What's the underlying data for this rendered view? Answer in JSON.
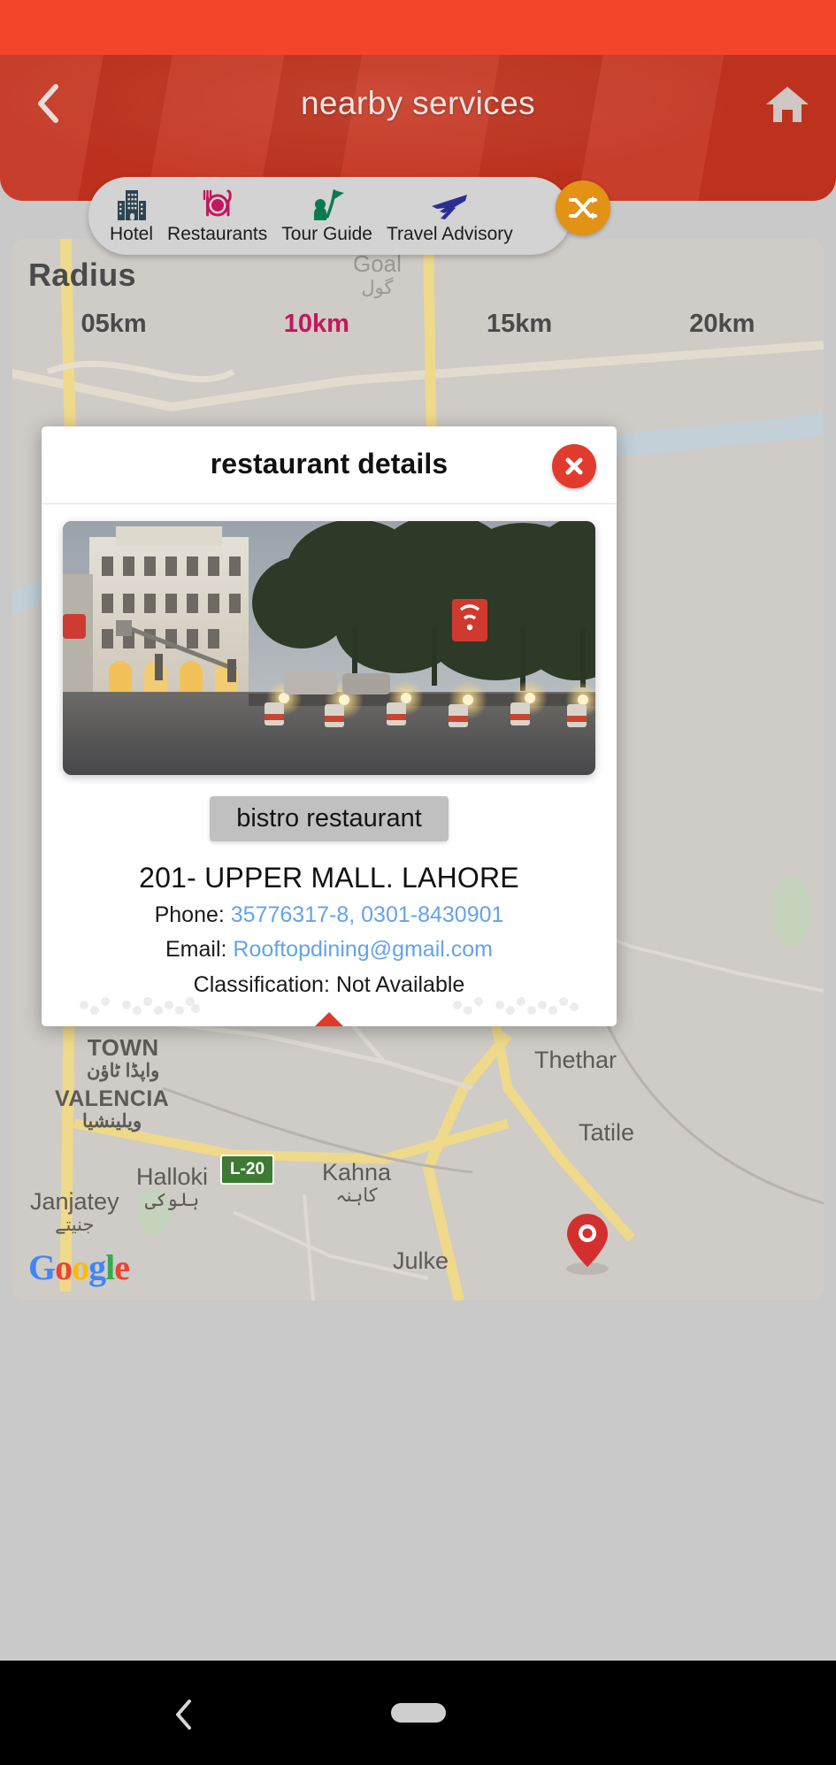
{
  "appbar": {
    "title": "nearby services",
    "back_icon": "chevron-left-icon",
    "home_icon": "home-icon"
  },
  "categories": [
    {
      "label": "Hotel",
      "icon": "hotel-building-icon"
    },
    {
      "label": "Restaurants",
      "icon": "restaurant-plate-cutlery-icon"
    },
    {
      "label": "Tour Guide",
      "icon": "tour-guide-person-flag-icon"
    },
    {
      "label": "Travel Advisory",
      "icon": "airplane-icon"
    }
  ],
  "shuffle": {
    "icon": "shuffle-icon",
    "color": "#e29214"
  },
  "radius": {
    "title": "Radius",
    "options": [
      "05km",
      "10km",
      "15km",
      "20km"
    ],
    "selected": "10km",
    "selected_color": "#c2185b"
  },
  "modal": {
    "title": "restaurant details",
    "close_icon": "close-x-icon",
    "photo_caption": "restaurant exterior night photo",
    "name_badge": "bistro restaurant",
    "address": "201- UPPER MALL. LAHORE",
    "phone_label": "Phone: ",
    "phone_value": "35776317-8, 0301-8430901",
    "email_label": "Email: ",
    "email_value": "Rooftopdining@gmail.com",
    "classification": "Classification: Not Available",
    "directions_icon": "turn-right-directions-icon",
    "link_color": "#63a4e8",
    "directions_color": "#e23b2e"
  },
  "map": {
    "goal_label": "Goal",
    "goal_label_urdu": "گول",
    "labels": [
      {
        "name": "TOWN",
        "sub": "واپڈا ٹاؤن"
      },
      {
        "name": "VALENCIA",
        "sub": "ویلینشیا"
      },
      {
        "name": "Halloki",
        "sub": "ہلوکی"
      },
      {
        "name": "Kahna",
        "sub": "کاہنہ"
      },
      {
        "name": "Thethar",
        "sub": ""
      },
      {
        "name": "Tatile",
        "sub": ""
      },
      {
        "name": "Janjatey",
        "sub": "جنیتے"
      },
      {
        "name": "Julke",
        "sub": ""
      }
    ],
    "road_shield": "L-20",
    "attribution": "Google",
    "marker_icon": "map-pin-icon"
  },
  "navbar": {
    "back_icon": "nav-back-icon",
    "home_pill": "nav-home-pill"
  }
}
